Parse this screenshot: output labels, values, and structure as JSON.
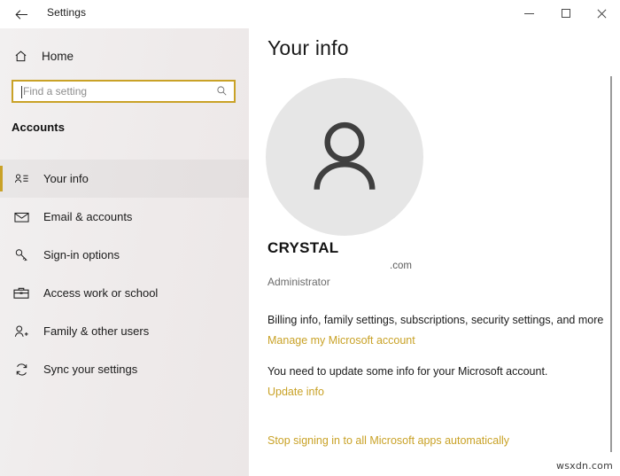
{
  "window": {
    "title": "Settings",
    "back_icon": "back-arrow-icon",
    "minimize_label": "Minimize",
    "maximize_label": "Maximize",
    "close_label": "Close"
  },
  "sidebar": {
    "home": {
      "label": "Home",
      "icon": "home-icon"
    },
    "search": {
      "placeholder": "Find a setting",
      "value": "",
      "icon": "search-icon"
    },
    "section_title": "Accounts",
    "items": [
      {
        "label": "Your info",
        "icon": "contact-card-icon",
        "selected": true
      },
      {
        "label": "Email & accounts",
        "icon": "envelope-icon",
        "selected": false
      },
      {
        "label": "Sign-in options",
        "icon": "key-icon",
        "selected": false
      },
      {
        "label": "Access work or school",
        "icon": "briefcase-icon",
        "selected": false
      },
      {
        "label": "Family & other users",
        "icon": "person-add-icon",
        "selected": false
      },
      {
        "label": "Sync your settings",
        "icon": "sync-arrows-icon",
        "selected": false
      }
    ]
  },
  "main": {
    "page_title": "Your info",
    "avatar_icon": "person-avatar-icon",
    "account_name": "CRYSTAL",
    "account_email": ".com",
    "account_role": "Administrator",
    "billing_line": "Billing info, family settings, subscriptions, security settings, and more",
    "link_manage": "Manage my Microsoft account",
    "update_note": "You need to update some info for your Microsoft account.",
    "link_update": "Update info",
    "link_stop": "Stop signing in to all Microsoft apps automatically"
  },
  "watermark": "wsxdn.com",
  "colors": {
    "accent": "#c9a227",
    "sidebar_bg": "#efeded",
    "content_bg": "#ffffff",
    "avatar_bg": "#e6e6e6",
    "text_primary": "#1b1b1b",
    "text_secondary": "#6b6b6b"
  }
}
